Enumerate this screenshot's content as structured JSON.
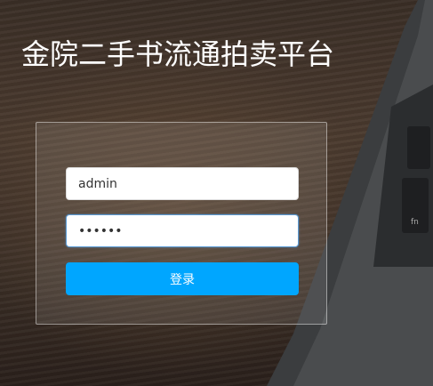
{
  "header": {
    "title": "金院二手书流通拍卖平台"
  },
  "login": {
    "username_value": "admin",
    "password_value": "••••••",
    "submit_label": "登录"
  },
  "colors": {
    "button": "#00a6ff",
    "title": "#ffffff"
  }
}
